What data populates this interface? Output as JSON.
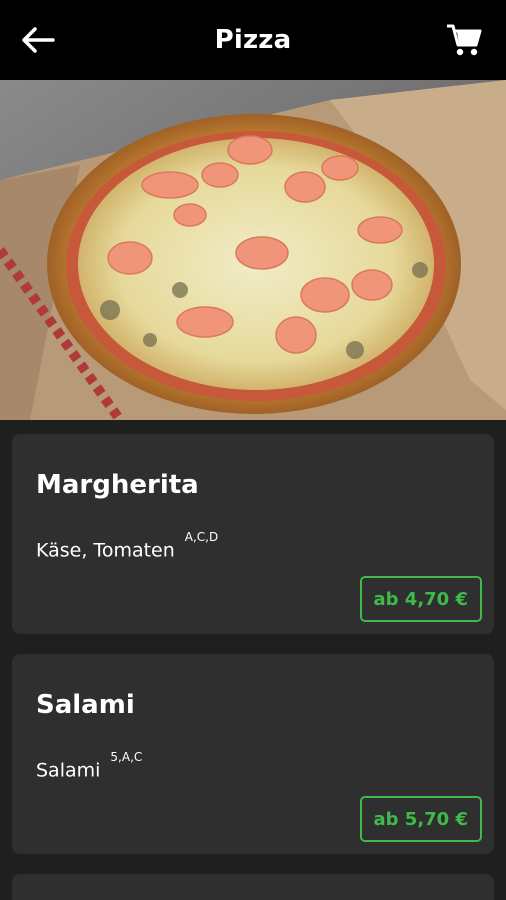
{
  "header": {
    "title": "Pizza"
  },
  "icons": {
    "back": "arrow-left-icon",
    "cart": "cart-icon"
  },
  "colors": {
    "topbar": "#000000",
    "background": "#1f1f1f",
    "card": "#2f2f2f",
    "price_accent": "#3fb94a"
  },
  "menu": {
    "items": [
      {
        "name": "Margherita",
        "ingredients": "Käse, Tomaten",
        "allergens": "A,C,D",
        "price": "ab 4,70 €"
      },
      {
        "name": "Salami",
        "ingredients": "Salami",
        "allergens": "5,A,C",
        "price": "ab 5,70 €"
      }
    ]
  }
}
